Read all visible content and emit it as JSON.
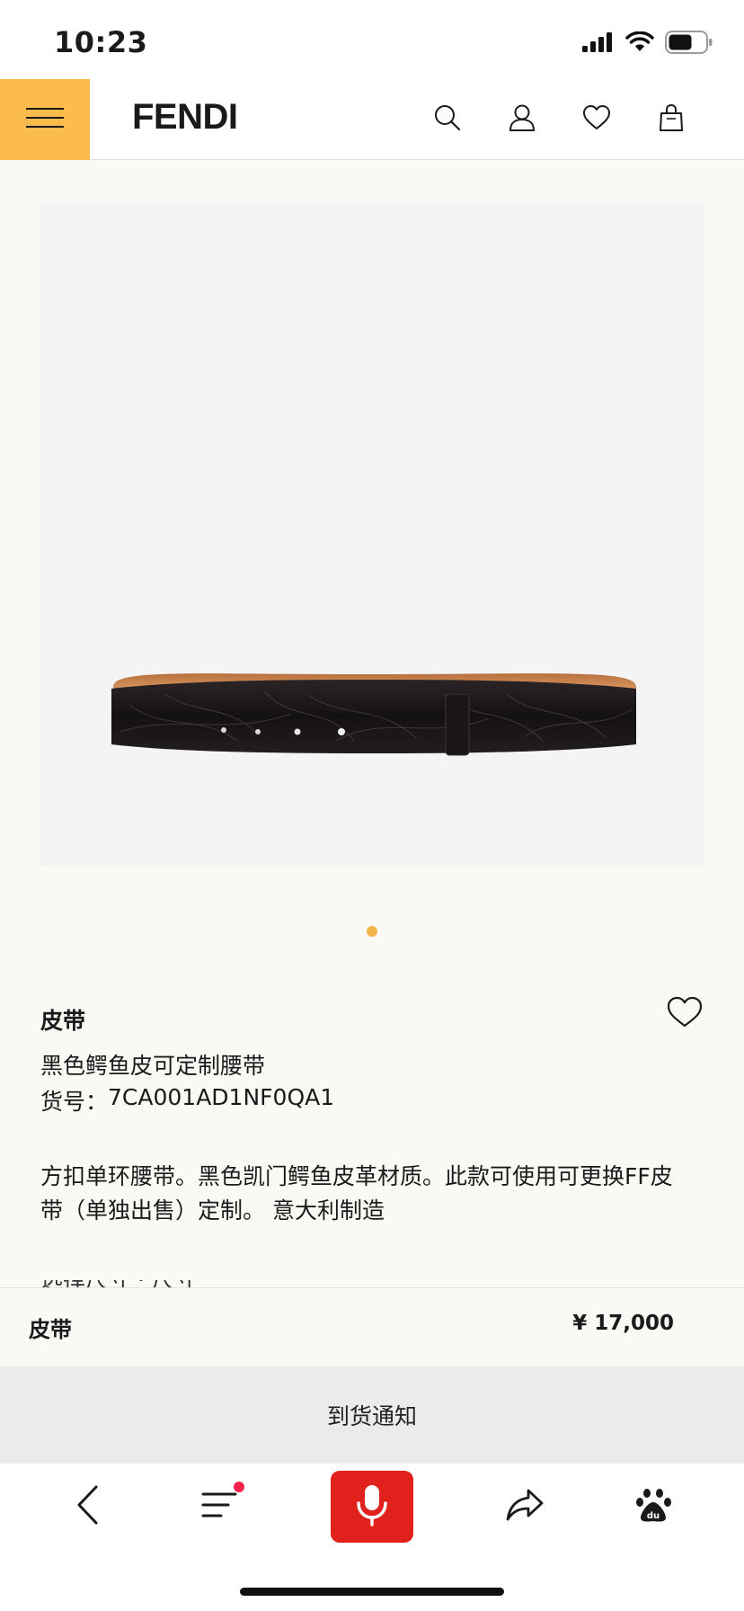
{
  "status_bar": {
    "time": "10:23",
    "icons": [
      "signal-icon",
      "wifi-icon",
      "battery-icon"
    ]
  },
  "header": {
    "brand": "FENDI",
    "menu_icon": "hamburger-menu-icon",
    "accent_color": "#fbbb4d",
    "icons": [
      "search-icon",
      "account-icon",
      "wishlist-heart-icon",
      "shopping-bag-icon"
    ]
  },
  "gallery": {
    "image_alt": "black crocodile leather belt",
    "dot_color": "#f2b54a"
  },
  "product": {
    "category": "皮带",
    "name": "黑色鳄鱼皮可定制腰带",
    "sku_label": "货号：",
    "sku_value": "7CA001AD1NF0QA1",
    "description_line1": "方扣单环腰带。黑色凯门鳄鱼皮革材质。此款可使用可更换FF皮",
    "description_line2": "带（单独出售）定制。 意大利制造",
    "clipped_text": "选择尺寸 · 尺寸"
  },
  "price_bar": {
    "name": "皮带",
    "price": "¥ 17,000"
  },
  "notify_button": {
    "label": "到货通知"
  },
  "browser_toolbar": {
    "icons": [
      "back-icon",
      "menu-list-icon",
      "microphone-icon",
      "share-icon",
      "baidu-paw-icon"
    ],
    "mic_color": "#e0211c"
  }
}
